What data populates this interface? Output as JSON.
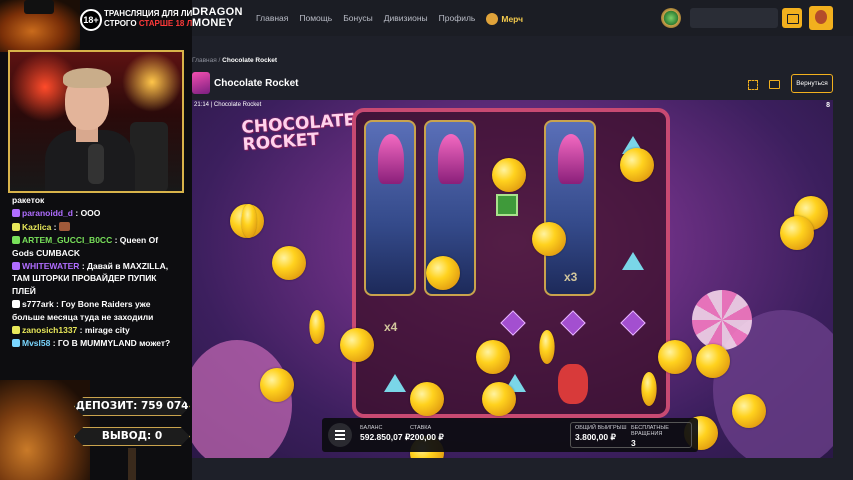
{
  "overlay": {
    "age_badge": "18+",
    "warning_line1": "ТРАНСЛЯЦИЯ ДЛЯ ЛИЦ",
    "warning_line2_a": "СТРОГО",
    "warning_line2_b": "СТАРШЕ 18 ЛЕТ",
    "deposit": "ДЕПОЗИТ: 759 074",
    "withdraw": "ВЫВОД: 0"
  },
  "chat": [
    {
      "nick": "",
      "msg": "ракеток",
      "color": "#ffffff"
    },
    {
      "nick": "paranoidd_d",
      "msg": " : ООО",
      "color": "#b06dff"
    },
    {
      "nick": "Kazlica",
      "msg": " : ",
      "color": "#e8e85a",
      "emote": true
    },
    {
      "nick": "ARTEM_GUCCI_B0CC",
      "msg": " : Queen Of Gods CUMBACK",
      "color": "#78e05a"
    },
    {
      "nick": "WHITEWATER",
      "msg": " : Давай в MAXZILLA, ТАМ ШТОРКИ ПРОВАЙДЕР ПУПИК ПЛЕЙ",
      "color": "#b06dff"
    },
    {
      "nick": "s777ark",
      "msg": " : Гоу Bone Raiders уже больше месяца туда не заходили",
      "color": "#ffffff"
    },
    {
      "nick": "zanosich1337",
      "msg": " : mirage city",
      "color": "#e8e85a"
    },
    {
      "nick": "Mvsl58",
      "msg": " : ГО В MUMMYLAND может?",
      "color": "#7ad6ff"
    }
  ],
  "header": {
    "logo_line1": "DRAGON",
    "logo_line2": "MONEY",
    "nav": [
      "Главная",
      "Помощь",
      "Бонусы",
      "Дивизионы",
      "Профиль"
    ],
    "merch": "Мерч",
    "search_placeholder": ""
  },
  "page": {
    "breadcrumb_home": "Главная",
    "breadcrumb_sep": " / ",
    "breadcrumb_current": "Chocolate Rocket",
    "title": "Chocolate Rocket",
    "back_button": "Вернуться"
  },
  "game": {
    "clock": "21:14",
    "frame_title": "Chocolate Rocket",
    "logo_line1": "CHOCOLATE",
    "logo_line2": "ROCKET",
    "multipliers": [
      "x4",
      "x3",
      "x3"
    ],
    "balance_label": "БАЛАНС",
    "balance": "592.850,07 ₽",
    "bet_label": "СТАВКА",
    "bet": "200,00 ₽",
    "total_win_label": "ОБЩИЙ ВЫИГРЫШ",
    "total_win": "3.800,00 ₽",
    "free_spins_label": "БЕСПЛАТНЫЕ ВРАЩЕНИЯ",
    "free_spins": "3",
    "corner_mark": "8"
  }
}
